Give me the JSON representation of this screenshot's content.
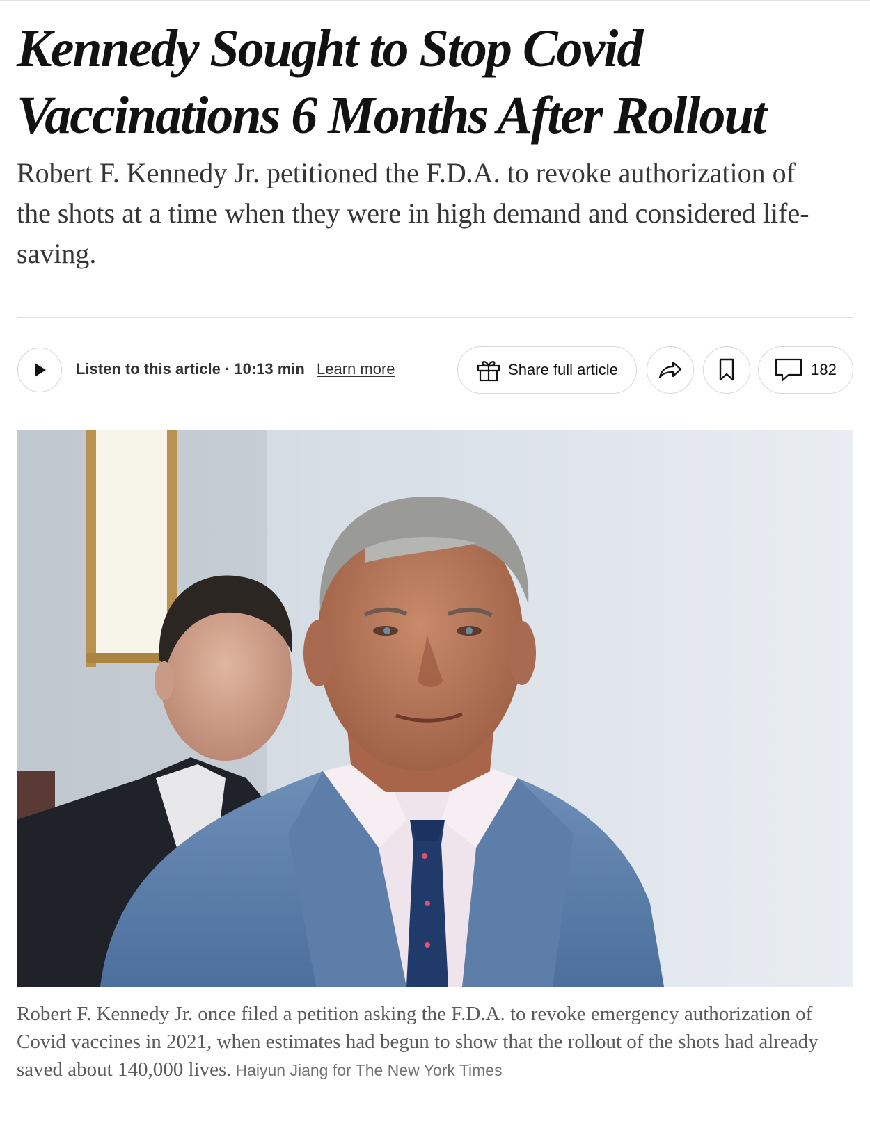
{
  "article": {
    "headline": "Kennedy Sought to Stop Covid Vaccinations 6 Months After Rollout",
    "summary": "Robert F. Kennedy Jr. petitioned the F.D.A. to revoke authorization of the shots at a time when they were in high demand and considered life-saving."
  },
  "toolbar": {
    "listen_label": "Listen to this article · 10:13 min",
    "learn_more": "Learn more",
    "share_full_label": "Share full article",
    "comment_count": "182",
    "icons": {
      "play": "play-icon",
      "gift": "gift-icon",
      "share": "share-arrow-icon",
      "bookmark": "bookmark-icon",
      "comment": "comment-bubble-icon"
    }
  },
  "image": {
    "caption": "Robert F. Kennedy Jr. once filed a petition asking the F.D.A. to revoke emergency authorization of Covid vaccines in 2021, when estimates had begun to show that the rollout of the shots had already saved about 140,000 lives.",
    "credit": "Haiyun Jiang for The New York Times"
  }
}
